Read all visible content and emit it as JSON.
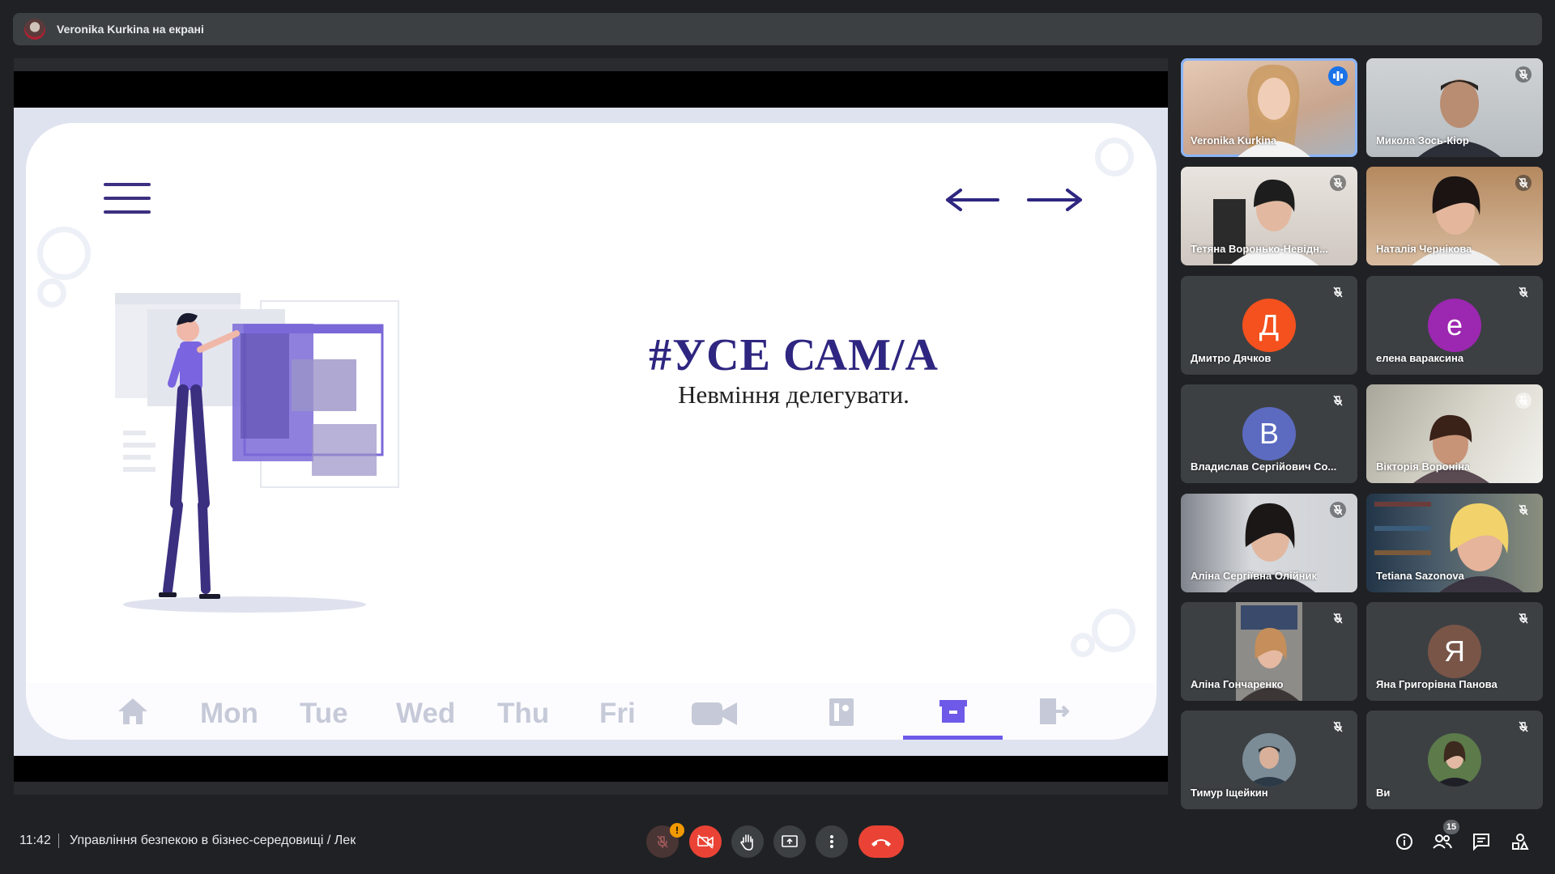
{
  "banner": {
    "text": "Veronika Kurkina на екрані"
  },
  "slide": {
    "hashtag": "#УСЕ САМ/А",
    "subtitle": "Невміння делегувати.",
    "nav": [
      "Mon",
      "Tue",
      "Wed",
      "Thu",
      "Fri"
    ],
    "icons": [
      "home-icon",
      "video-icon",
      "contact-icon",
      "archive-icon",
      "exit-icon"
    ]
  },
  "participants": [
    {
      "name": "Veronika Kurkina",
      "type": "video",
      "speaking": true
    },
    {
      "name": "Микола Зось-Кіор",
      "type": "video"
    },
    {
      "name": "Тетяна Воронько-Невідн...",
      "type": "video"
    },
    {
      "name": "Наталія Чернікова",
      "type": "video"
    },
    {
      "name": "Дмитро Дячков",
      "type": "initial",
      "initial": "Д",
      "color": "#f4511e"
    },
    {
      "name": "елена вараксина",
      "type": "initial",
      "initial": "е",
      "color": "#9c27b0"
    },
    {
      "name": "Владислав Сергійович Со...",
      "type": "initial",
      "initial": "В",
      "color": "#5c6bc0"
    },
    {
      "name": "Вікторія Вороніна",
      "type": "video"
    },
    {
      "name": "Аліна Сергіївна Олійник",
      "type": "video"
    },
    {
      "name": "Tetiana Sazonova",
      "type": "video"
    },
    {
      "name": "Аліна Гончаренко",
      "type": "video"
    },
    {
      "name": "Яна Григорівна Панова",
      "type": "initial",
      "initial": "Я",
      "color": "#795548"
    },
    {
      "name": "Тимур Іщейкин",
      "type": "avatar"
    },
    {
      "name": "Ви",
      "type": "avatar"
    }
  ],
  "bottom": {
    "time": "11:42",
    "separator": "|",
    "meeting_title": "Управління безпекою в бізнес-середовищі / Лек",
    "warning": "!",
    "participants_count": "15"
  },
  "colors": {
    "accent": "#1a73e8",
    "hangup": "#ea4335",
    "slide_title": "#2e2680"
  }
}
